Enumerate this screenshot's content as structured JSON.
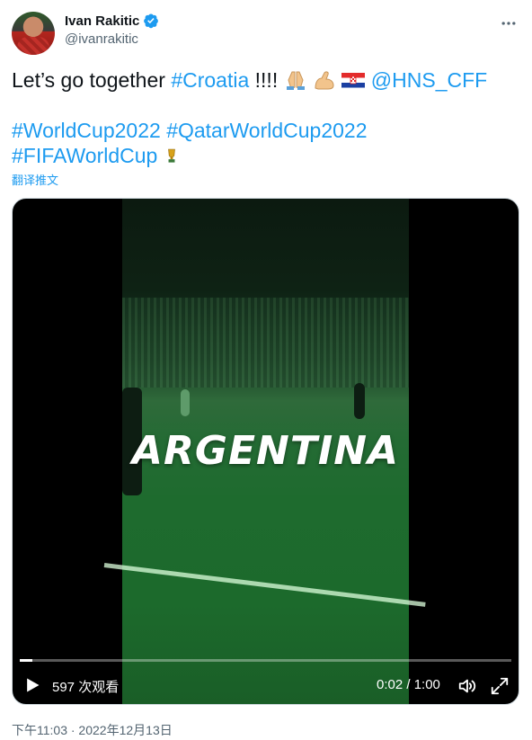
{
  "author": {
    "display_name": "Ivan Rakitic",
    "handle": "@ivanrakitic",
    "verified": true
  },
  "tweet": {
    "line1_prefix": "Let’s go together ",
    "line1_tag": "#Croatia",
    "line1_suffix": " !!!! ",
    "emojis": [
      "folded-hands-icon",
      "flexed-biceps-icon",
      "croatia-flag-icon"
    ],
    "mention": "@HNS_CFF",
    "tags_line2": [
      "#WorldCup2022",
      "#QatarWorldCup2022"
    ],
    "tag_line3": "#FIFAWorldCup",
    "trophy": "trophy-icon",
    "translate_label": "翻译推文"
  },
  "video": {
    "overlay_text": "ARGENTINA",
    "views": "597 次观看",
    "time": "0:02 / 1:00",
    "progress": 0.02
  },
  "timestamp": "下午11:03 · 2022年12月13日",
  "colors": {
    "link": "#1d9bf0",
    "text": "#0f1419",
    "muted": "#536471"
  }
}
